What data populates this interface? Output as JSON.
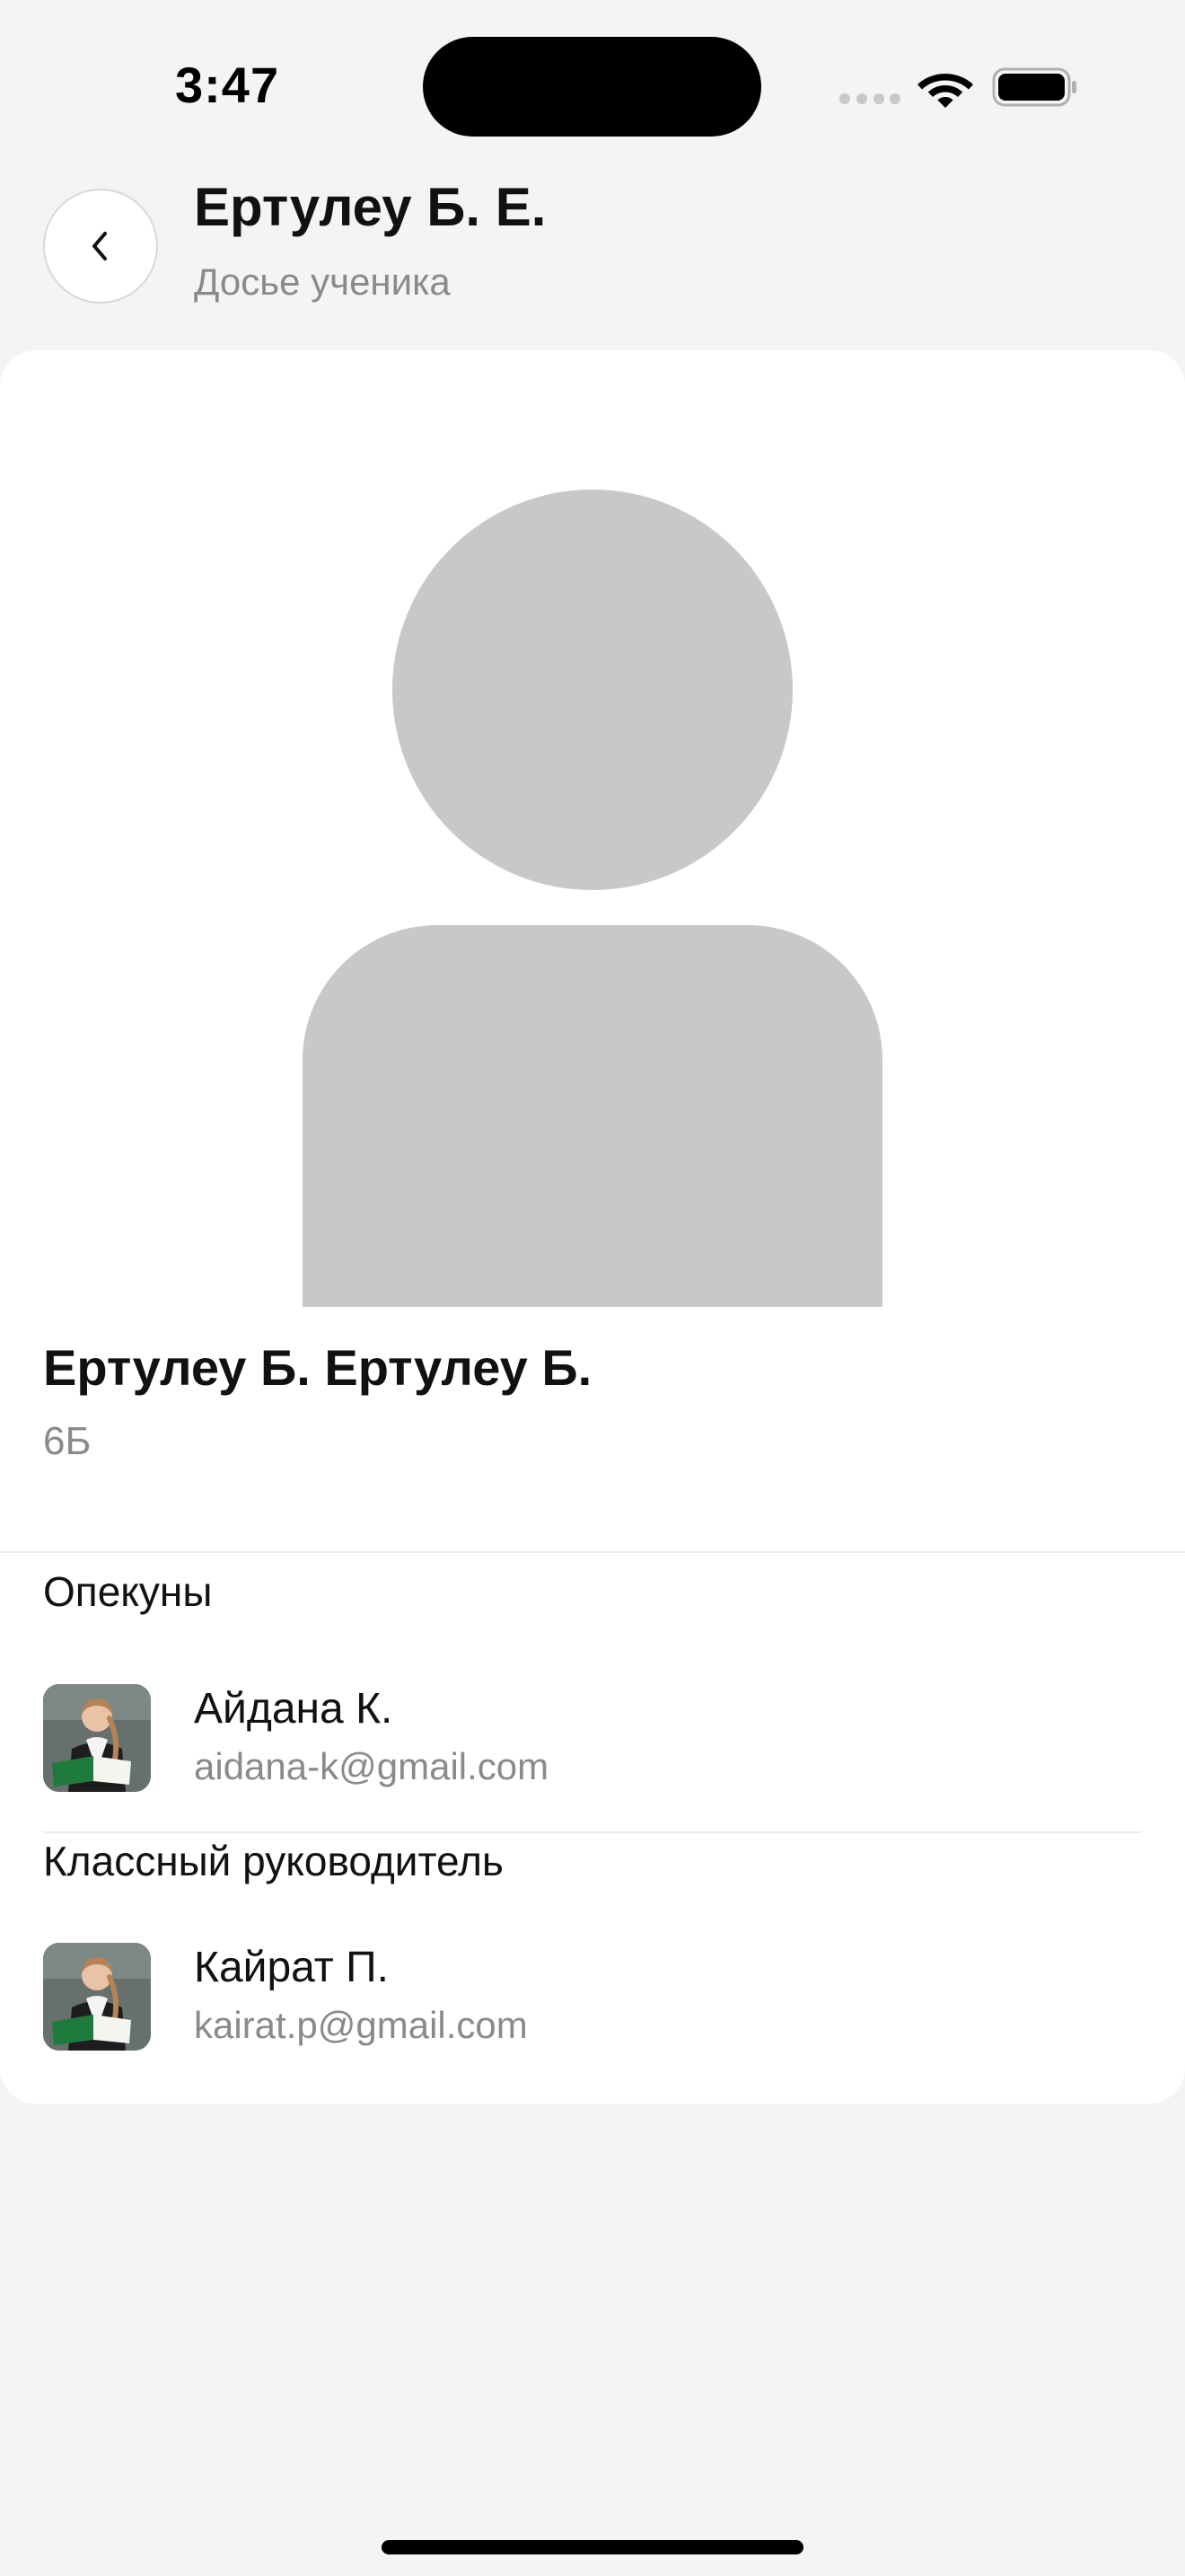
{
  "status_bar": {
    "time": "3:47"
  },
  "header": {
    "title": "Ертулеу Б. Е.",
    "subtitle": "Досье ученика",
    "back_icon": "chevron-left-icon"
  },
  "student": {
    "full_name": "Ертулеу Б. Ертулеу Б.",
    "class": "6Б",
    "avatar_icon": "person-placeholder-icon",
    "avatar_color": "#c8c8c8"
  },
  "guardians": {
    "heading": "Опекуны",
    "items": [
      {
        "name": "Айдана К.",
        "email": "aidana-k@gmail.com"
      }
    ]
  },
  "class_teacher": {
    "heading": "Классный руководитель",
    "items": [
      {
        "name": "Кайрат П.",
        "email": "kairat.p@gmail.com"
      }
    ]
  },
  "colors": {
    "background": "#f4f4f4",
    "card": "#ffffff",
    "muted_text": "#8a8a8a",
    "divider": "#ececec"
  }
}
